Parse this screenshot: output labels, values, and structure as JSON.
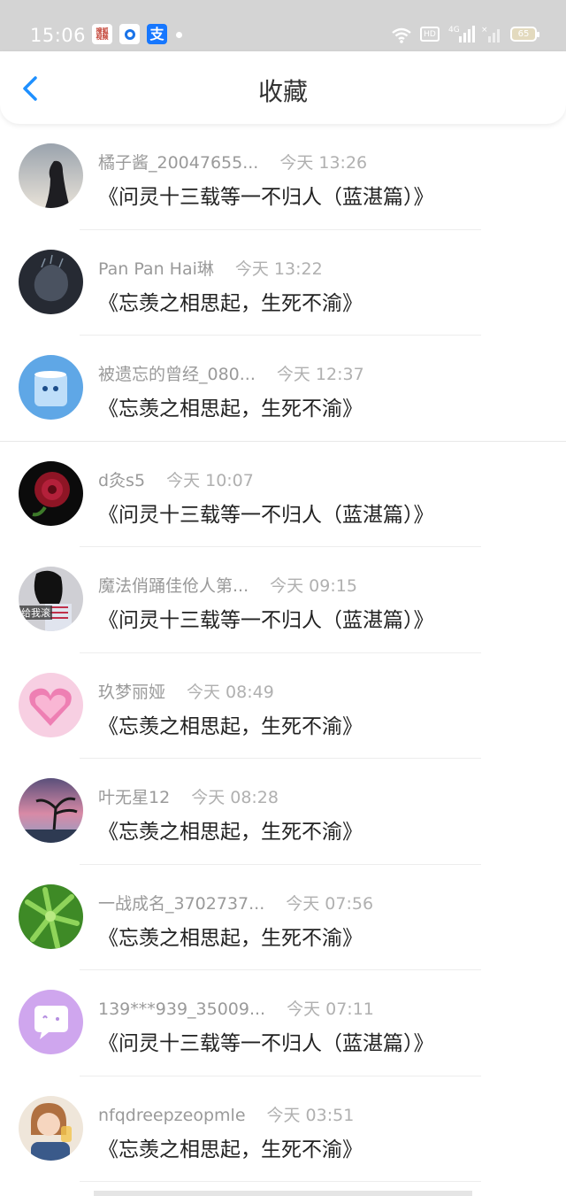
{
  "status_bar": {
    "time": "15:06",
    "apps": [
      "sohu-video-icon",
      "target-app-icon",
      "alipay-icon"
    ],
    "hd_label": "HD",
    "network": "4G",
    "battery": "65"
  },
  "header": {
    "title": "收藏",
    "back_icon": "chevron-left-icon",
    "accent": "#1e90ff"
  },
  "favorites": [
    {
      "user": "橘子酱_20047655...",
      "time": "今天 13:26",
      "title": "《问灵十三载等一不归人（蓝湛篇）》",
      "avatar": "girl-silhouette-avatar"
    },
    {
      "user": "Pan Pan Hai琳",
      "time": "今天 13:22",
      "title": "《忘羡之相思起，生死不渝》",
      "avatar": "dark-portrait-avatar"
    },
    {
      "user": "被遗忘的曾经_080...",
      "time": "今天 12:37",
      "title": "《忘羡之相思起，生死不渝》",
      "avatar": "glass-cup-avatar"
    },
    {
      "user": "d灸s5",
      "time": "今天 10:07",
      "title": "《问灵十三载等一不归人（蓝湛篇）》",
      "avatar": "red-rose-avatar"
    },
    {
      "user": "魔法俏踊佳伧人第...",
      "time": "今天 09:15",
      "title": "《问灵十三载等一不归人（蓝湛篇）》",
      "avatar": "girl-sticker-avatar",
      "avatar_text": "给我滚"
    },
    {
      "user": "玖梦丽娅",
      "time": "今天 08:49",
      "title": "《忘羡之相思起，生死不渝》",
      "avatar": "pink-heart-avatar"
    },
    {
      "user": "叶无星12",
      "time": "今天 08:28",
      "title": "《忘羡之相思起，生死不渝》",
      "avatar": "sunset-tree-avatar"
    },
    {
      "user": "一战成名_3702737...",
      "time": "今天 07:56",
      "title": "《忘羡之相思起，生死不渝》",
      "avatar": "green-plant-avatar"
    },
    {
      "user": "139***939_35009...",
      "time": "今天 07:11",
      "title": "《问灵十三载等一不归人（蓝湛篇）》",
      "avatar": "default-chat-avatar"
    },
    {
      "user": "nfqdreepzeopmle",
      "time": "今天 03:51",
      "title": "《忘羡之相思起，生死不渝》",
      "avatar": "girl-photo-avatar"
    }
  ]
}
